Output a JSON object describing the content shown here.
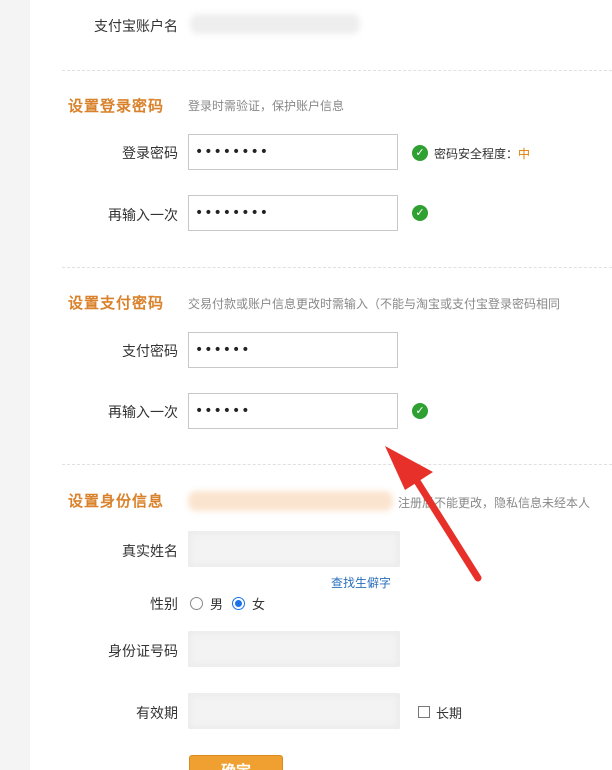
{
  "account": {
    "label": "支付宝账户名"
  },
  "login_password": {
    "title": "设置登录密码",
    "hint": "登录时需验证，保护账户信息",
    "field_label": "登录密码",
    "field_value": "••••••••",
    "strength_prefix": "密码安全程度：",
    "strength_value": "中",
    "confirm_label": "再输入一次",
    "confirm_value": "••••••••"
  },
  "pay_password": {
    "title": "设置支付密码",
    "hint": "交易付款或账户信息更改时需输入（不能与淘宝或支付宝登录密码相同",
    "field_label": "支付密码",
    "field_value": "••••••",
    "confirm_label": "再输入一次",
    "confirm_value": "••••••"
  },
  "identity": {
    "title": "设置身份信息",
    "hint_partial": "注册后不能更改，隐私信息未经本人",
    "name_label": "真实姓名",
    "rare_char_link": "查找生僻字",
    "gender_label": "性别",
    "gender_male": "男",
    "gender_female": "女",
    "gender_selected": "女",
    "id_label": "身份证号码",
    "expiry_label": "有效期",
    "long_term_label": "长期"
  },
  "submit": {
    "label": "确定"
  },
  "colors": {
    "section_title": "#d9822b",
    "check_green": "#2fa032",
    "strength_orange": "#e07b00",
    "link_blue": "#2a6fbd",
    "arrow_red": "#e8302a",
    "button_orange": "#f0a030"
  }
}
